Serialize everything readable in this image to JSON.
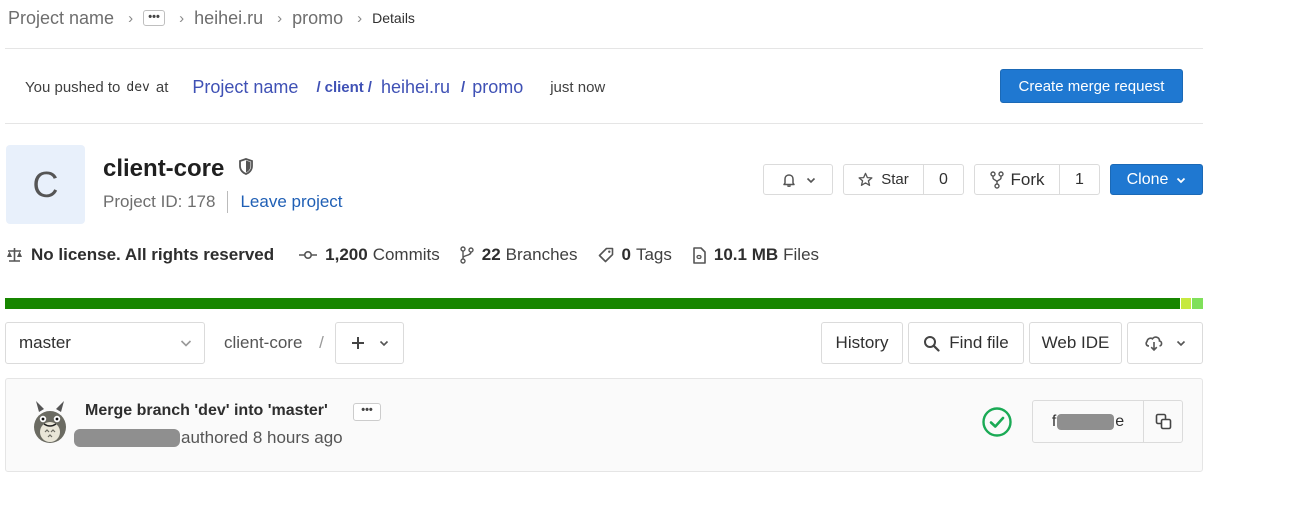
{
  "breadcrumb": {
    "items": [
      "Project name",
      "heihei.ru",
      "promo"
    ],
    "ellipsis": "•••",
    "current": "Details",
    "separator": "›"
  },
  "push_banner": {
    "prefix": "You pushed to",
    "branch": "dev",
    "at": "at",
    "path": [
      "Project name",
      "client",
      "heihei.ru",
      "promo"
    ],
    "path_separator": "/",
    "time": "just now",
    "button_label": "Create merge request"
  },
  "project": {
    "avatar_letter": "C",
    "name": "client-core",
    "id_label": "Project ID: 178",
    "leave_label": "Leave project",
    "actions": {
      "star_label": "Star",
      "star_count": "0",
      "fork_label": "Fork",
      "fork_count": "1",
      "clone_label": "Clone"
    }
  },
  "stats": [
    {
      "icon": "scale-icon",
      "bold": "No license. All rights reserved",
      "text": ""
    },
    {
      "icon": "commit-icon",
      "bold": "1,200",
      "text": "Commits"
    },
    {
      "icon": "branch-icon",
      "bold": "22",
      "text": "Branches"
    },
    {
      "icon": "tag-icon",
      "bold": "0",
      "text": "Tags"
    },
    {
      "icon": "file-icon",
      "bold": "10.1 MB",
      "text": "Files"
    }
  ],
  "language_bar": [
    {
      "fraction": 0.981,
      "color": "#178600"
    },
    {
      "fraction": 0.009,
      "color": "#c6e940"
    },
    {
      "fraction": 0.01,
      "color": "#7fe05a"
    }
  ],
  "tree": {
    "branch": "master",
    "path_root": "client-core",
    "path_separator": "/",
    "buttons": {
      "history": "History",
      "find_file": "Find file",
      "web_ide": "Web IDE"
    }
  },
  "commit": {
    "title": "Merge branch 'dev' into 'master'",
    "more": "•••",
    "authored": "authored 8 hours ago",
    "sha_start": "f",
    "sha_end": "e"
  },
  "colors": {
    "primary": "#1f78d1",
    "link": "#3f51b5",
    "success": "#1aaa55"
  }
}
